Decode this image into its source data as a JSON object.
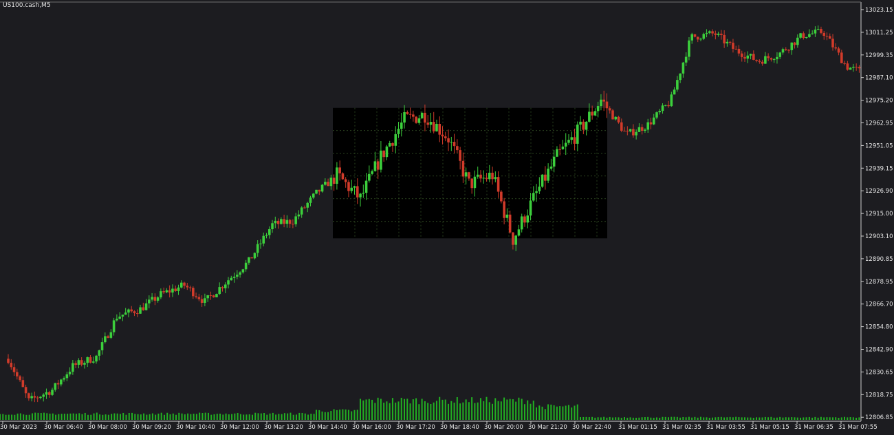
{
  "chart_title": "US100.cash,M5",
  "colors": {
    "background": "#1c1c20",
    "axis": "#d0d0d0",
    "bull": "#3ccf3c",
    "bear": "#d13b2a",
    "volume": "#22b022",
    "highlight_box": "#000000",
    "grid": "#3a5a2a"
  },
  "chart_data": {
    "type": "candlestick",
    "title": "US100.cash,M5",
    "timeframe": "M5",
    "ylim": [
      12800.95,
      13029.1
    ],
    "y_ticks": [
      "13023.15",
      "13011.25",
      "12999.35",
      "12987.10",
      "12975.20",
      "12962.95",
      "12951.05",
      "12939.15",
      "12926.90",
      "12915.00",
      "12903.10",
      "12890.85",
      "12878.95",
      "12866.70",
      "12854.80",
      "12842.90",
      "12830.65",
      "12818.75",
      "12806.85"
    ],
    "x_ticks": [
      "30 Mar 2023",
      "30 Mar 06:40",
      "30 Mar 08:00",
      "30 Mar 09:20",
      "30 Mar 10:40",
      "30 Mar 12:00",
      "30 Mar 13:20",
      "30 Mar 14:40",
      "30 Mar 16:00",
      "30 Mar 17:20",
      "30 Mar 18:40",
      "30 Mar 20:00",
      "30 Mar 21:20",
      "30 Mar 22:40",
      "31 Mar 01:15",
      "31 Mar 02:35",
      "31 Mar 03:55",
      "31 Mar 05:15",
      "31 Mar 06:35",
      "31 Mar 07:55"
    ],
    "highlight_region": {
      "from": "30 Mar 14:40",
      "to": "30 Mar 22:40",
      "price_low": 12900.5,
      "price_high": 12971.5,
      "grid": "dotted"
    },
    "price_path": [
      {
        "x": "30 Mar 2023",
        "close": 12835
      },
      {
        "x": "30 Mar 2023",
        "close": 12812
      },
      {
        "x": "30 Mar 06:40",
        "close": 12818
      },
      {
        "x": "30 Mar 06:40",
        "close": 12831
      },
      {
        "x": "30 Mar 08:00",
        "close": 12836
      },
      {
        "x": "30 Mar 08:00",
        "close": 12858
      },
      {
        "x": "30 Mar 09:20",
        "close": 12862
      },
      {
        "x": "30 Mar 09:20",
        "close": 12870
      },
      {
        "x": "30 Mar 10:40",
        "close": 12875
      },
      {
        "x": "30 Mar 10:40",
        "close": 12866
      },
      {
        "x": "30 Mar 12:00",
        "close": 12878
      },
      {
        "x": "30 Mar 12:00",
        "close": 12888
      },
      {
        "x": "30 Mar 13:20",
        "close": 12908
      },
      {
        "x": "30 Mar 13:20",
        "close": 12910
      },
      {
        "x": "30 Mar 14:40",
        "close": 12925
      },
      {
        "x": "30 Mar 14:40",
        "close": 12935
      },
      {
        "x": "30 Mar 16:00",
        "close": 12922
      },
      {
        "x": "30 Mar 16:00",
        "close": 12945
      },
      {
        "x": "30 Mar 17:20",
        "close": 12965
      },
      {
        "x": "30 Mar 17:20",
        "close": 12968
      },
      {
        "x": "30 Mar 18:40",
        "close": 12955
      },
      {
        "x": "30 Mar 18:40",
        "close": 12930
      },
      {
        "x": "30 Mar 20:00",
        "close": 12935
      },
      {
        "x": "30 Mar 20:00",
        "close": 12900
      },
      {
        "x": "30 Mar 21:20",
        "close": 12925
      },
      {
        "x": "30 Mar 21:20",
        "close": 12945
      },
      {
        "x": "30 Mar 22:40",
        "close": 12960
      },
      {
        "x": "30 Mar 22:40",
        "close": 12976
      },
      {
        "x": "31 Mar 01:15",
        "close": 12957
      },
      {
        "x": "31 Mar 01:15",
        "close": 12962
      },
      {
        "x": "31 Mar 02:35",
        "close": 12975
      },
      {
        "x": "31 Mar 02:35",
        "close": 13010
      },
      {
        "x": "31 Mar 03:55",
        "close": 13012
      },
      {
        "x": "31 Mar 03:55",
        "close": 13003
      },
      {
        "x": "31 Mar 05:15",
        "close": 12997
      },
      {
        "x": "31 Mar 05:15",
        "close": 13001
      },
      {
        "x": "31 Mar 06:35",
        "close": 13011
      },
      {
        "x": "31 Mar 06:35",
        "close": 13013
      },
      {
        "x": "31 Mar 07:55",
        "close": 12994
      },
      {
        "x": "31 Mar 07:55",
        "close": 12990
      }
    ],
    "volume_levels": [
      {
        "from": "30 Mar 2023",
        "to": "30 Mar 14:40",
        "level": 0.12
      },
      {
        "from": "30 Mar 14:40",
        "to": "30 Mar 16:00",
        "level": 0.18
      },
      {
        "from": "30 Mar 16:00",
        "to": "30 Mar 21:20",
        "level": 0.38
      },
      {
        "from": "30 Mar 21:20",
        "to": "30 Mar 22:40",
        "level": 0.26
      },
      {
        "from": "30 Mar 22:40",
        "to": "31 Mar 07:55",
        "level": 0.05
      }
    ]
  }
}
